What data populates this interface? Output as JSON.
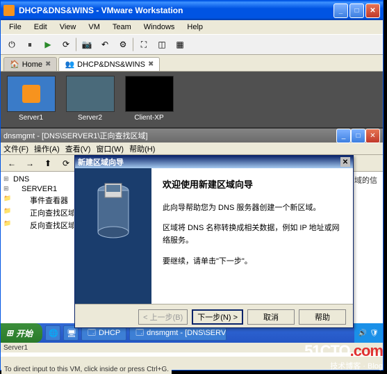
{
  "vmware": {
    "title": "DHCP&DNS&WINS - VMware Workstation",
    "menu": [
      "File",
      "Edit",
      "View",
      "VM",
      "Team",
      "Windows",
      "Help"
    ],
    "tabs": [
      {
        "label": "Home",
        "active": false
      },
      {
        "label": "DHCP&DNS&WINS",
        "active": true
      }
    ],
    "thumbs": [
      {
        "label": "Server1"
      },
      {
        "label": "Server2"
      },
      {
        "label": "Client-XP"
      }
    ]
  },
  "guest": {
    "title": "dnsmgmt - [DNS\\SERVER1\\正向查找区域]",
    "menu": [
      "文件(F)",
      "操作(A)",
      "查看(V)",
      "窗口(W)",
      "帮助(H)"
    ],
    "tree": {
      "root": "DNS",
      "server": "SERVER1",
      "items": [
        "事件查看器",
        "正向查找区域",
        "反向查找区域"
      ]
    },
    "content_hint": "域的信"
  },
  "wizard": {
    "title": "新建区域向导",
    "heading": "欢迎使用新建区域向导",
    "p1": "此向导帮助您为 DNS 服务器创建一个新区域。",
    "p2": "区域将 DNS 名称转换成相关数据，例如 IP 地址或网络服务。",
    "p3": "要继续，请单击\"下一步\"。",
    "buttons": {
      "back": "< 上一步(B)",
      "next": "下一步(N) >",
      "cancel": "取消",
      "help": "帮助"
    }
  },
  "taskbar": {
    "start": "开始",
    "items": [
      "DHCP",
      "dnsmgmt - [DNS\\SERV..."
    ]
  },
  "status": {
    "vm_label": "Server1",
    "hint": "To direct input to this VM, click inside or press Ctrl+G."
  },
  "watermark": {
    "main_a": "51CTO",
    "main_b": ".com",
    "sub": "技术博客 · Blog"
  }
}
